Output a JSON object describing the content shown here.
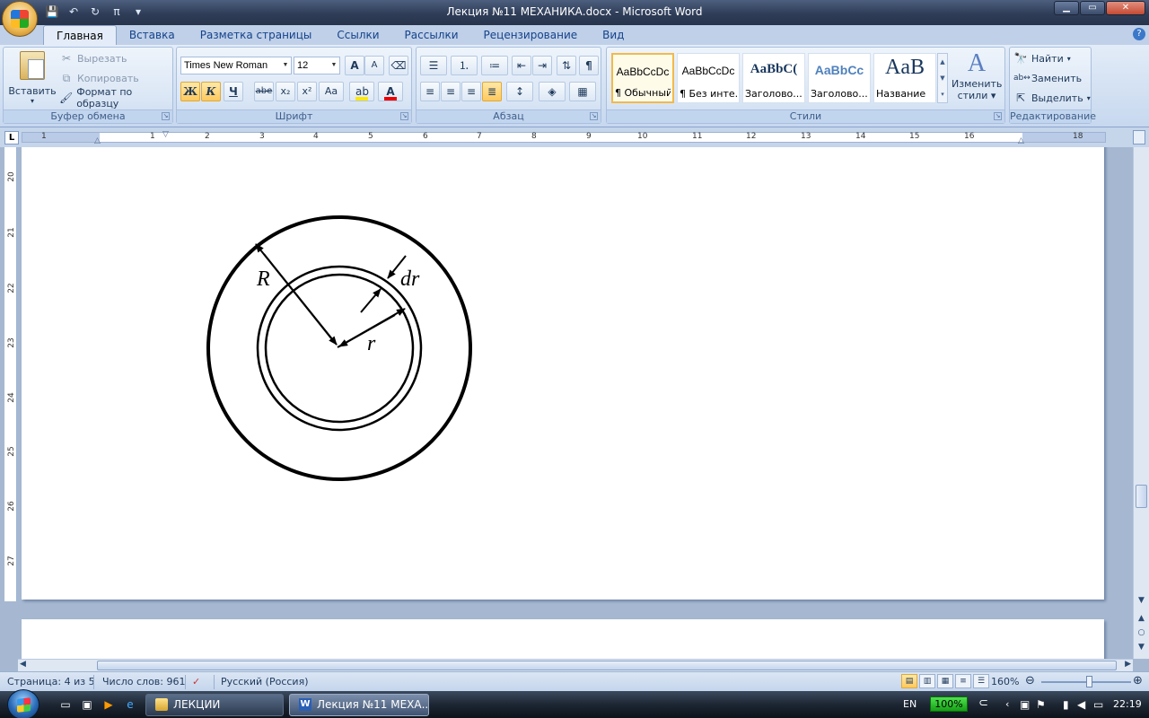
{
  "window": {
    "title": "Лекция №11 МЕХАНИКА.docx - Microsoft Word",
    "minimize": "▁",
    "maximize": "▭",
    "close": "✕"
  },
  "quick_access": {
    "save_icon": "save-icon",
    "undo_icon": "undo-icon",
    "redo_icon": "redo-icon",
    "pi_label": "π"
  },
  "tabs": [
    {
      "label": "Главная",
      "active": true
    },
    {
      "label": "Вставка"
    },
    {
      "label": "Разметка страницы"
    },
    {
      "label": "Ссылки"
    },
    {
      "label": "Рассылки"
    },
    {
      "label": "Рецензирование"
    },
    {
      "label": "Вид"
    }
  ],
  "ribbon": {
    "clipboard": {
      "label": "Буфер обмена",
      "paste": "Вставить",
      "cut": "Вырезать",
      "copy": "Копировать",
      "format_painter": "Формат по образцу"
    },
    "font": {
      "label": "Шрифт",
      "family": "Times New Roman",
      "size": "12",
      "bold": "Ж",
      "italic": "К",
      "underline": "Ч",
      "strike": "abe",
      "subscript": "x₂",
      "superscript": "x²",
      "change_case": "Aa",
      "grow": "A",
      "shrink": "A"
    },
    "paragraph": {
      "label": "Абзац",
      "pilcrow": "¶"
    },
    "styles": {
      "label": "Стили",
      "items": [
        {
          "sample": "AaBbCcDc",
          "name": "¶ Обычный",
          "active": true
        },
        {
          "sample": "AaBbCcDc",
          "name": "¶ Без инте..."
        },
        {
          "sample": "AaBbC(",
          "name": "Заголово..."
        },
        {
          "sample": "AaBbCc",
          "name": "Заголово..."
        },
        {
          "sample": "AaB",
          "name": "Название"
        }
      ],
      "change_styles_line1": "Изменить",
      "change_styles_line2": "стили"
    },
    "editing": {
      "label": "Редактирование",
      "find": "Найти",
      "replace": "Заменить",
      "select": "Выделить"
    }
  },
  "ruler": {
    "corner": "L",
    "numbers": [
      "1",
      "1",
      "2",
      "3",
      "4",
      "5",
      "6",
      "7",
      "8",
      "9",
      "10",
      "11",
      "12",
      "13",
      "14",
      "15",
      "16",
      "18"
    ],
    "vnumbers": [
      "20",
      "21",
      "22",
      "23",
      "24",
      "25",
      "26",
      "27"
    ]
  },
  "diagram": {
    "label_R": "R",
    "label_dr": "dr",
    "label_r": "r"
  },
  "status": {
    "page": "Страница: 4 из 5",
    "words": "Число слов: 961",
    "language": "Русский (Россия)",
    "zoom": "160%",
    "zoom_level": 160
  },
  "taskbar": {
    "tasks": [
      {
        "label": "ЛЕКЦИИ",
        "icon": "folder-icon"
      },
      {
        "label": "Лекция №11 МЕХА...",
        "icon": "word-icon",
        "active": true
      }
    ],
    "lang": "EN",
    "battery": "100%",
    "clock": "22:19"
  }
}
